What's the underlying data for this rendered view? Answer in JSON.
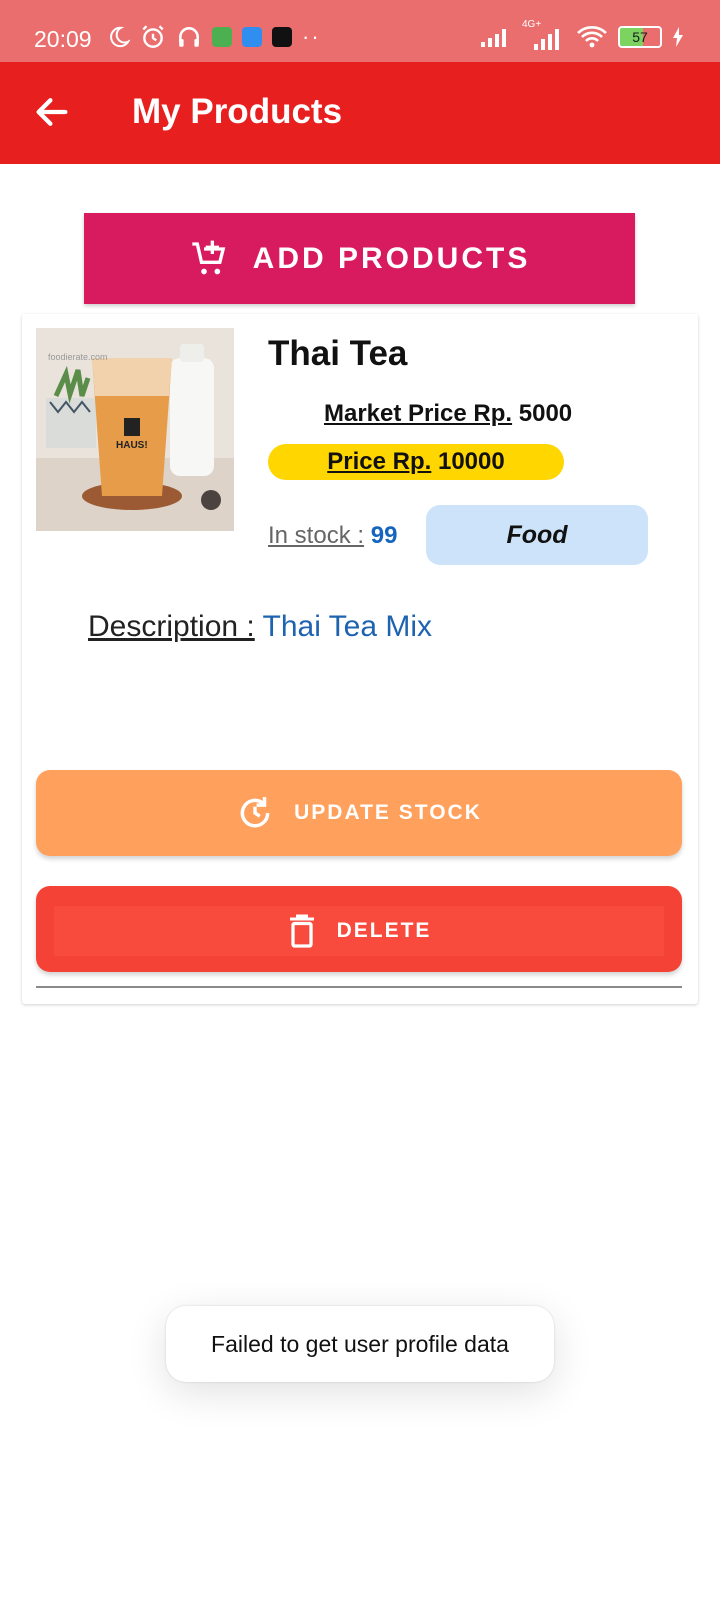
{
  "status_bar": {
    "time": "20:09",
    "network_label": "4G+",
    "battery": "57",
    "icons": [
      "moon-icon",
      "alarm-icon",
      "headphones-icon",
      "app-icon",
      "app-icon",
      "tiktok-icon",
      "more-dots-icon",
      "signal-icon",
      "signal-4g-icon",
      "wifi-icon",
      "battery-icon",
      "charging-icon"
    ]
  },
  "app_bar": {
    "title": "My Products",
    "back_icon": "arrow-left-icon",
    "color": "#e81f1f"
  },
  "add_button": {
    "label": "ADD PRODUCTS",
    "icon": "add-cart-icon",
    "color": "#d81b5f"
  },
  "product": {
    "name": "Thai Tea",
    "market_price_label": "Market Price Rp.",
    "market_price_value": "5000",
    "price_label": "Price Rp.",
    "price_value": "10000",
    "stock_label": "In stock :",
    "stock_value": "99",
    "category": "Food",
    "description_label": "Description :",
    "description_value": "Thai Tea Mix",
    "image_watermark": "foodierate.com",
    "cup_label": "HAUS!"
  },
  "actions": {
    "update_label": "UPDATE STOCK",
    "update_icon": "refresh-clock-icon",
    "update_color": "#ffa05c",
    "delete_label": "DELETE",
    "delete_icon": "trash-icon",
    "delete_color": "#f44336"
  },
  "toast": {
    "message": "Failed to get user profile data"
  }
}
